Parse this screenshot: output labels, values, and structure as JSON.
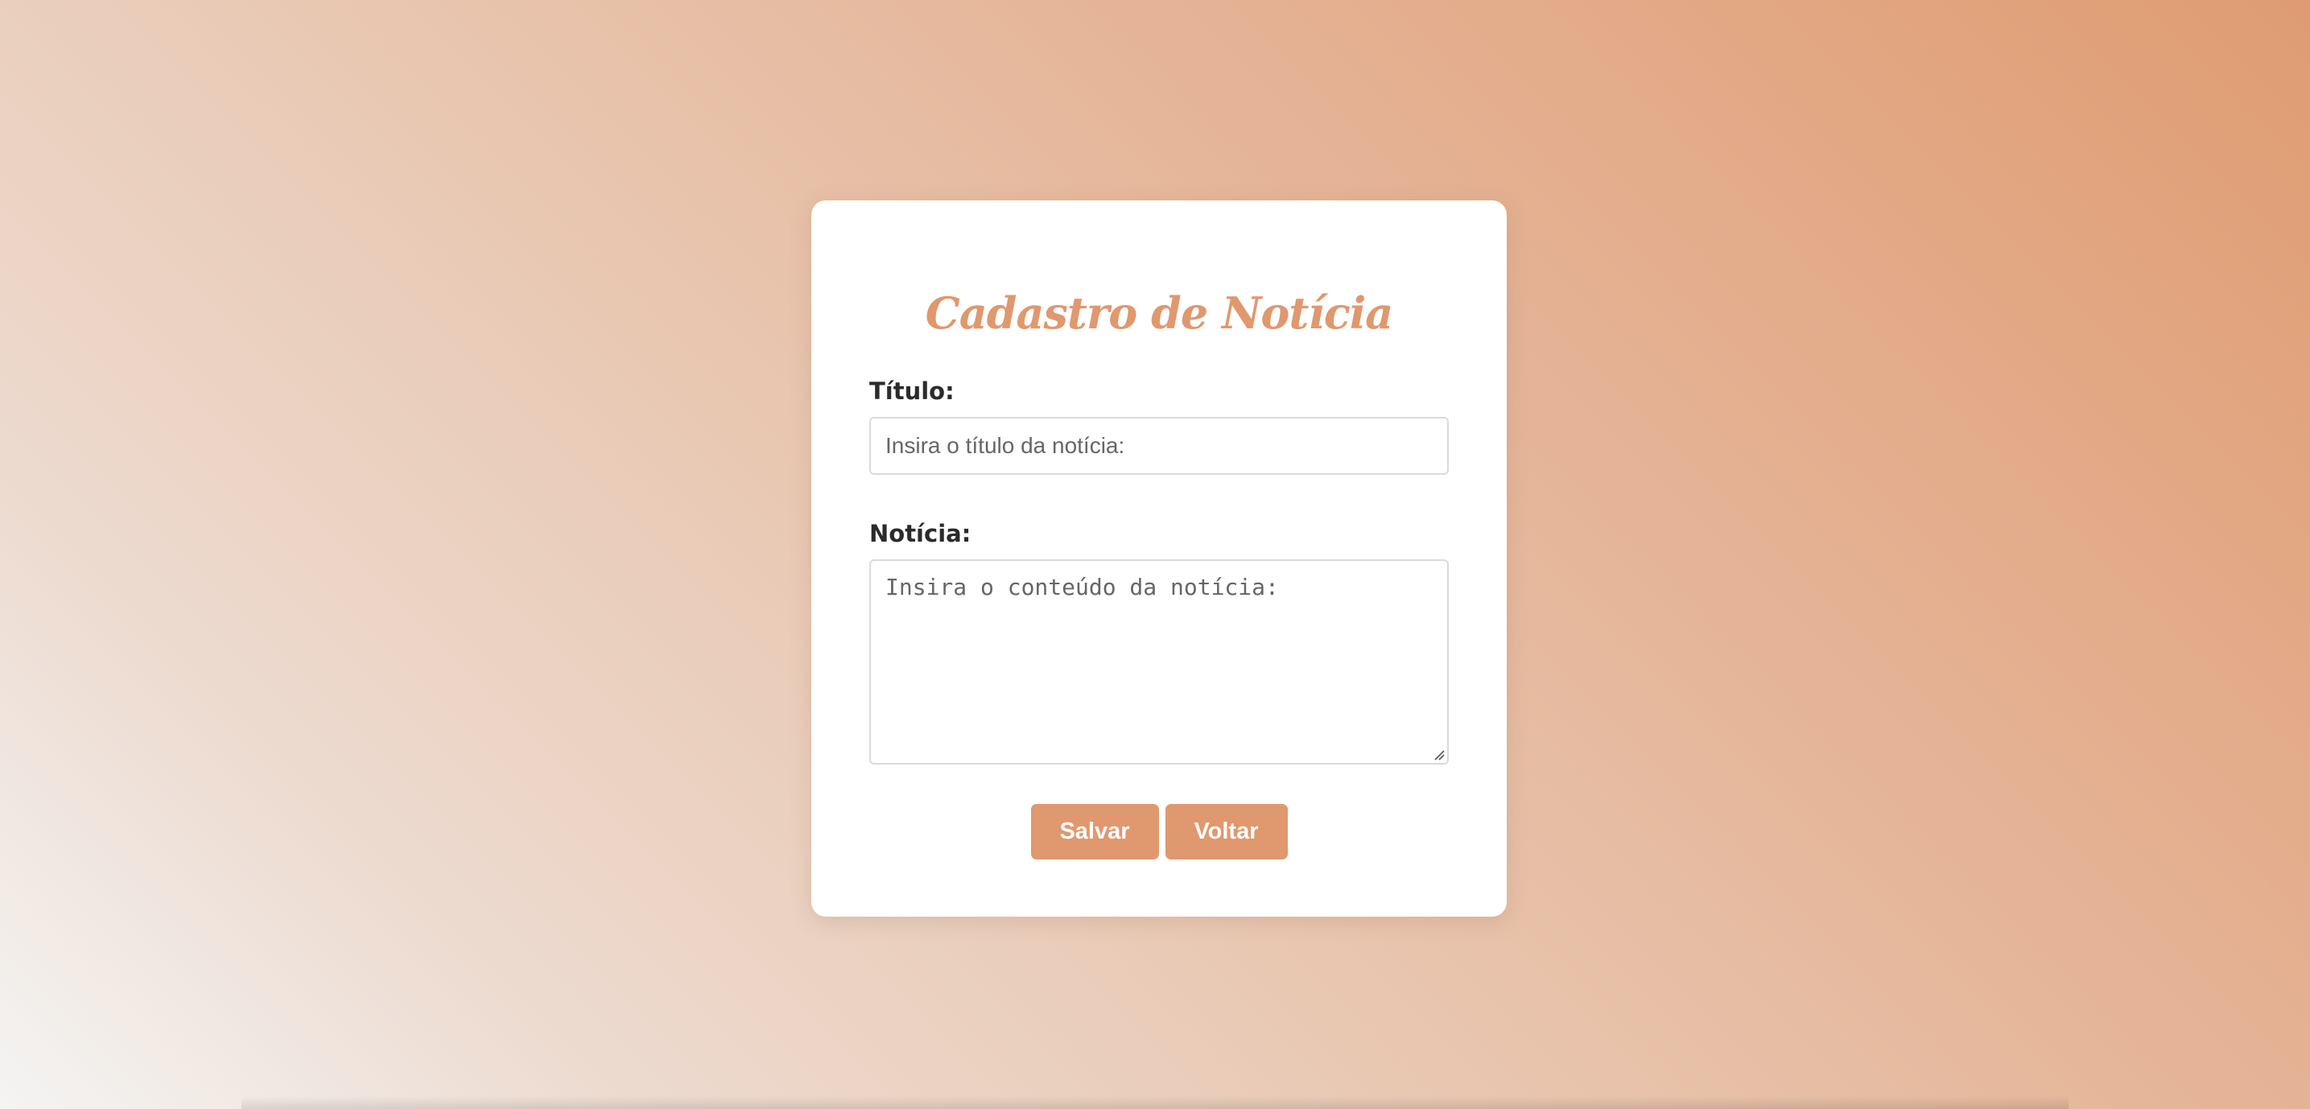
{
  "form": {
    "title": "Cadastro de Notícia",
    "titulo_label": "Título:",
    "titulo_placeholder": "Insira o título da notícia:",
    "noticia_label": "Notícia:",
    "noticia_placeholder": "Insira o conteúdo da notícia:",
    "save_label": "Salvar",
    "back_label": "Voltar"
  },
  "theme": {
    "accent": "#e0986e",
    "label_color": "#2b2b2b",
    "placeholder_color": "#666666",
    "border_color": "#dadada"
  }
}
